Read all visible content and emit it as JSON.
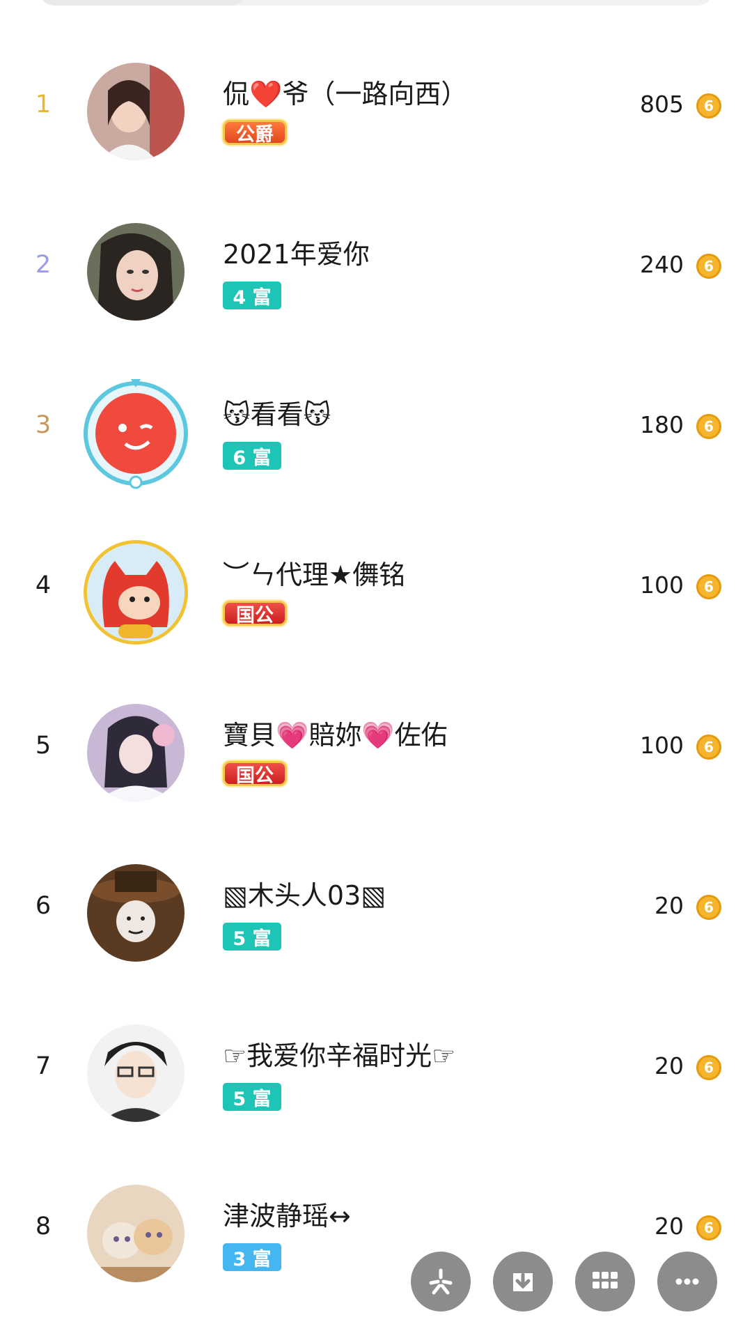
{
  "ranking": [
    {
      "rank": "1",
      "name": "侃❤️爷（一路向西）",
      "badge": "公爵",
      "badge_style": "noble-orange",
      "score": "805"
    },
    {
      "rank": "2",
      "name": "2021年爱你",
      "badge": "4 富",
      "badge_style": "teal",
      "score": "240"
    },
    {
      "rank": "3",
      "name": "😽看看😽",
      "badge": "6 富",
      "badge_style": "teal",
      "score": "180"
    },
    {
      "rank": "4",
      "name": "︶ㄣ代理★儛铭",
      "badge": "国公",
      "badge_style": "noble-red",
      "score": "100"
    },
    {
      "rank": "5",
      "name": "寶貝💗賠妳💗佐佑",
      "badge": "国公",
      "badge_style": "noble-red",
      "score": "100"
    },
    {
      "rank": "6",
      "name": "▧木头人03▧",
      "badge": "5 富",
      "badge_style": "teal",
      "score": "20"
    },
    {
      "rank": "7",
      "name": "☞我爱你辛福时光☞",
      "badge": "5 富",
      "badge_style": "teal",
      "score": "20"
    },
    {
      "rank": "8",
      "name": "津波静瑶↔",
      "badge": "3 富",
      "badge_style": "blue",
      "score": "20"
    }
  ],
  "coin_symbol": "6",
  "icons": {
    "coin": "coin-icon",
    "fab": [
      "sparkle-icon",
      "download-icon",
      "grid-icon",
      "more-icon"
    ]
  },
  "colors": {
    "rank_gold": "#e8b72c",
    "rank_silver": "#9b9be6",
    "rank_bronze": "#c9955a",
    "badge_teal": "#1ec4b6",
    "badge_blue": "#46b6f0",
    "coin": "#f5b52c",
    "fab": "#8c8c8c"
  }
}
